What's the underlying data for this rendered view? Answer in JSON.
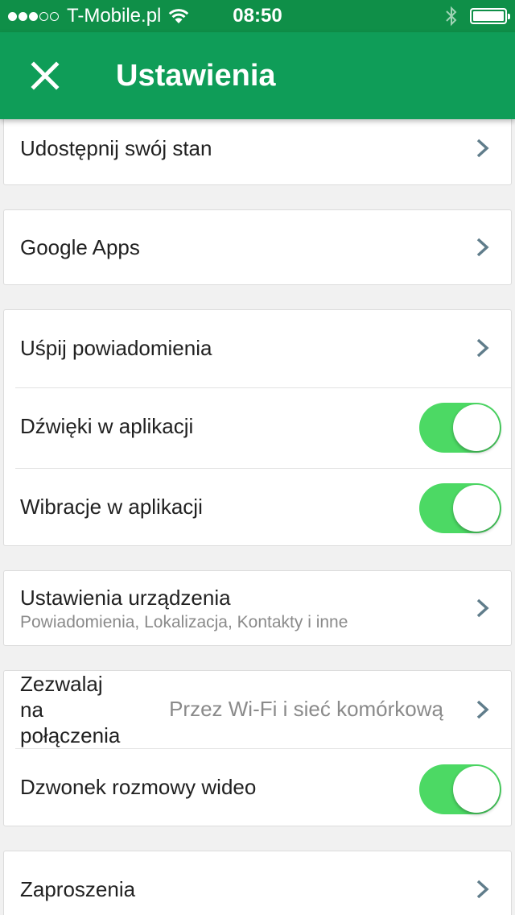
{
  "status_bar": {
    "carrier": "T-Mobile.pl",
    "time": "08:50",
    "signal_bars_filled": 3,
    "signal_bars_total": 5
  },
  "app_bar": {
    "title": "Ustawienia",
    "close_icon": "close-icon"
  },
  "settings": {
    "share_status": {
      "label": "Udostępnij swój stan"
    },
    "google_apps": {
      "label": "Google Apps"
    },
    "snooze_notifications": {
      "label": "Uśpij powiadomienia"
    },
    "in_app_sounds": {
      "label": "Dźwięki w aplikacji",
      "enabled": true
    },
    "in_app_vibration": {
      "label": "Wibracje w aplikacji",
      "enabled": true
    },
    "device_settings": {
      "label": "Ustawienia urządzenia",
      "sublabel": "Powiadomienia, Lokalizacja, Kontakty i inne"
    },
    "allow_calls": {
      "label_line1": "Zezwalaj",
      "label_line2": "na",
      "label_line3": "połączenia",
      "value": "Przez Wi-Fi i sieć komórkową"
    },
    "video_ringtone": {
      "label": "Dzwonek rozmowy wideo",
      "enabled": true
    },
    "invitations": {
      "label": "Zaproszenia"
    }
  },
  "colors": {
    "status_bar": "#0f8f48",
    "app_bar": "#0f9d58",
    "toggle_on": "#4cd964",
    "chevron": "#607d8b"
  }
}
